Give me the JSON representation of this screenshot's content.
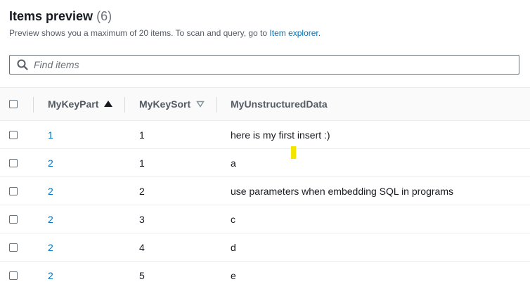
{
  "header": {
    "title": "Items preview",
    "count": "(6)",
    "subtitle_text": "Preview shows you a maximum of 20 items. To scan and query, go to ",
    "subtitle_link": "Item explorer",
    "subtitle_end": "."
  },
  "search": {
    "placeholder": "Find items",
    "value": ""
  },
  "table": {
    "columns": [
      {
        "label": "MyKeyPart",
        "sort": "ascending"
      },
      {
        "label": "MyKeySort",
        "sort": "sortable"
      },
      {
        "label": "MyUnstructuredData",
        "sort": "none"
      }
    ],
    "rows": [
      {
        "part": "1",
        "sort": "1",
        "data": "here is my first insert :)"
      },
      {
        "part": "2",
        "sort": "1",
        "data": "a"
      },
      {
        "part": "2",
        "sort": "2",
        "data": "use parameters when embedding SQL in programs"
      },
      {
        "part": "2",
        "sort": "3",
        "data": "c"
      },
      {
        "part": "2",
        "sort": "4",
        "data": "d"
      },
      {
        "part": "2",
        "sort": "5",
        "data": "e"
      }
    ]
  },
  "colors": {
    "link": "#0073bb",
    "cursor_highlight": "#f2e600"
  },
  "icons": {
    "search": "search-icon",
    "sort_asc": "sort-ascending-icon",
    "sort_default": "sort-descending-outline-icon"
  }
}
